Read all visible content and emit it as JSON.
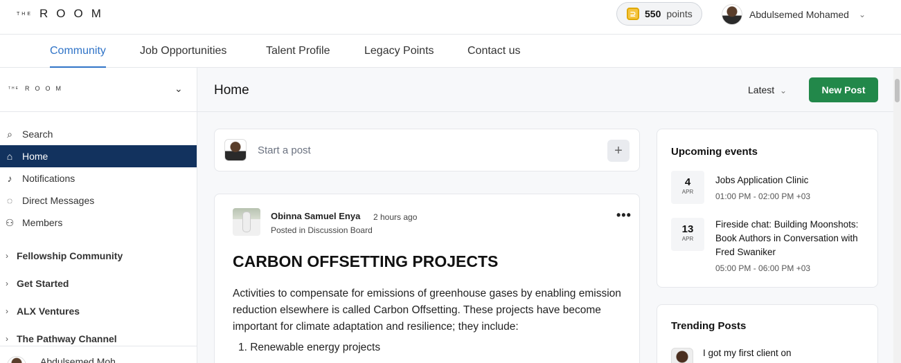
{
  "header": {
    "logo_small": "THE",
    "logo_word": "ROOM",
    "points_value": "550",
    "points_label": "points",
    "user_name": "Abdulsemed Mohamed"
  },
  "nav": {
    "tabs": [
      "Community",
      "Job Opportunities",
      "Talent Profile",
      "Legacy Points",
      "Contact us"
    ],
    "active": "Community"
  },
  "sidebar": {
    "logo_small": "THE",
    "logo_word": "ROOM",
    "items": [
      {
        "label": "Search",
        "icon": "search-icon"
      },
      {
        "label": "Home",
        "icon": "home-icon",
        "active": true
      },
      {
        "label": "Notifications",
        "icon": "bell-icon"
      },
      {
        "label": "Direct Messages",
        "icon": "chat-icon"
      },
      {
        "label": "Members",
        "icon": "members-icon"
      }
    ],
    "groups": [
      "Fellowship Community",
      "Get Started",
      "ALX Ventures",
      "The Pathway Channel"
    ],
    "footer_user": "Abdulsemed Moh"
  },
  "main": {
    "title": "Home",
    "sort_label": "Latest",
    "new_post_label": "New Post",
    "composer_placeholder": "Start a post",
    "post": {
      "author": "Obinna Samuel Enya",
      "time": "2 hours ago",
      "posted_in": "Posted in Discussion Board",
      "title": "CARBON OFFSETTING PROJECTS",
      "body": "Activities to compensate for emissions of greenhouse gases by enabling emission reduction elsewhere is called Carbon Offsetting. These projects have become important for climate adaptation and resilience; they include:",
      "list": [
        "1.  Renewable energy projects"
      ]
    }
  },
  "events": {
    "title": "Upcoming events",
    "items": [
      {
        "day": "4",
        "month": "APR",
        "name": "Jobs Application Clinic",
        "time": "01:00 PM - 02:00 PM +03"
      },
      {
        "day": "13",
        "month": "APR",
        "name": "Fireside chat: Building Moonshots: Book Authors in Conversation with Fred Swaniker",
        "time": "05:00 PM - 06:00 PM +03"
      }
    ]
  },
  "trending": {
    "title": "Trending Posts",
    "first_post": "I got my first client on"
  },
  "colors": {
    "accent": "#2f73c7",
    "sidebar_active": "#12325e",
    "primary_button": "#22884a"
  }
}
